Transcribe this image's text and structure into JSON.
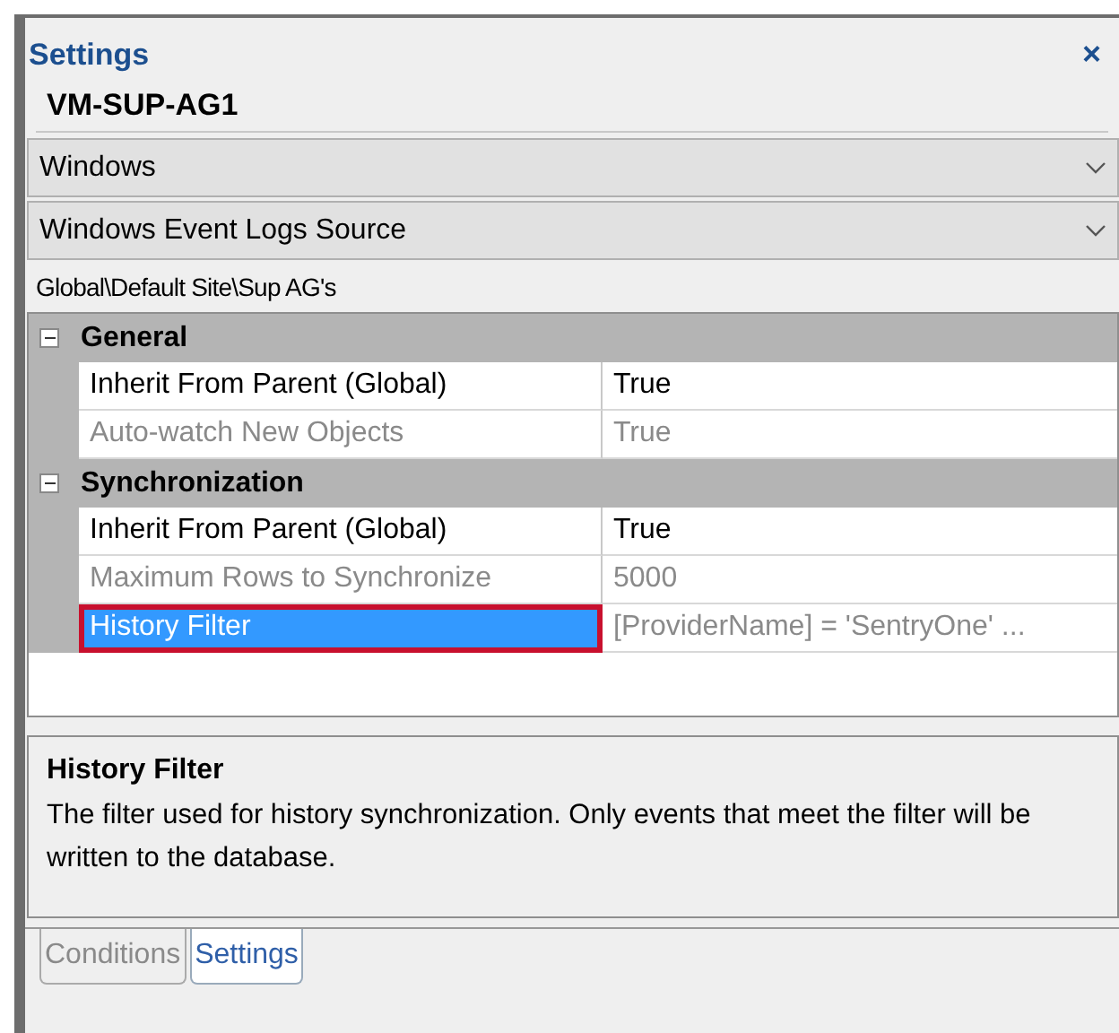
{
  "panel": {
    "title": "Settings",
    "close": "×"
  },
  "object_name": "VM-SUP-AG1",
  "dropdowns": [
    {
      "value": "Windows"
    },
    {
      "value": "Windows Event Logs Source"
    }
  ],
  "path": "Global\\Default Site\\Sup AG's",
  "property_grid": {
    "groups": [
      {
        "name": "General",
        "expanded": true,
        "items": [
          {
            "name": "Inherit From Parent (Global)",
            "value": "True",
            "disabled": false,
            "selected": false
          },
          {
            "name": "Auto-watch New Objects",
            "value": "True",
            "disabled": true,
            "selected": false
          }
        ]
      },
      {
        "name": "Synchronization",
        "expanded": true,
        "items": [
          {
            "name": "Inherit From Parent (Global)",
            "value": "True",
            "disabled": false,
            "selected": false
          },
          {
            "name": "Maximum Rows to Synchronize",
            "value": "5000",
            "disabled": true,
            "selected": false
          },
          {
            "name": "History Filter",
            "value": "[ProviderName] = 'SentryOne' ...",
            "disabled": true,
            "selected": true
          }
        ]
      }
    ]
  },
  "description": {
    "title": "History Filter",
    "text": "The filter used for history synchronization. Only events that meet the filter will be written to the database."
  },
  "tabs": [
    {
      "label": "Conditions",
      "selected": false
    },
    {
      "label": "Settings",
      "selected": true
    }
  ]
}
